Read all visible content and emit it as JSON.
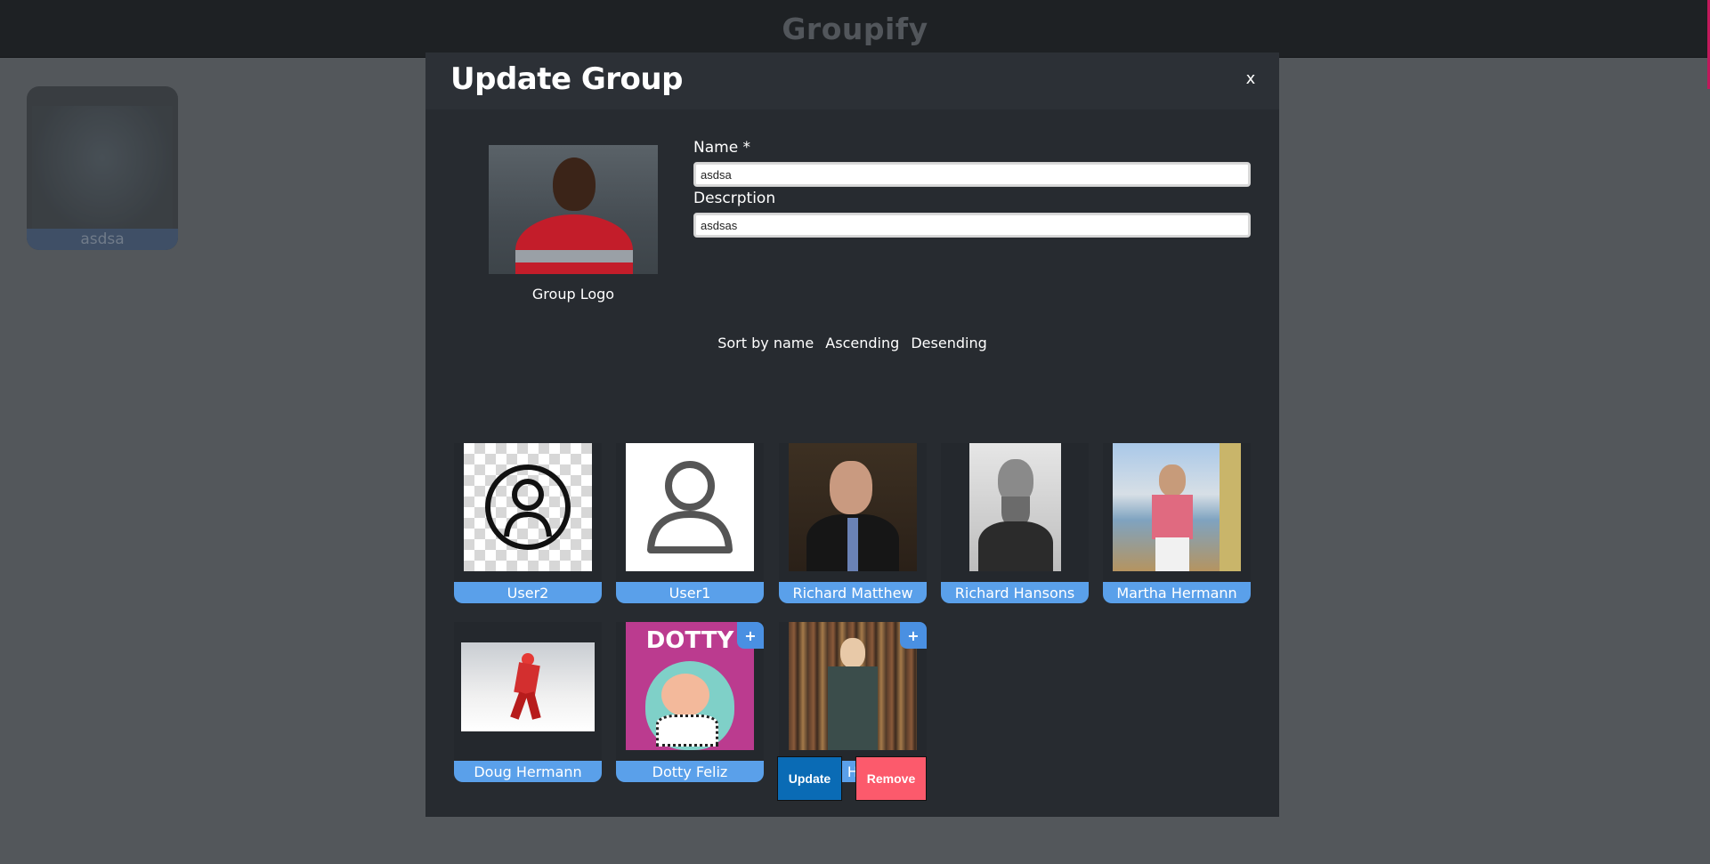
{
  "app": {
    "title": "Groupify"
  },
  "group_card": {
    "name": "asdsa"
  },
  "modal": {
    "title": "Update Group",
    "close_label": "x",
    "logo_caption": "Group Logo",
    "name_label": "Name *",
    "name_value": "asdsa",
    "description_label": "Descrption",
    "description_value": "asdsas",
    "sort": {
      "label": "Sort by name",
      "ascending": "Ascending",
      "descending": "Desending"
    },
    "add_label": "+",
    "members": [
      {
        "name": "User2"
      },
      {
        "name": "User1"
      },
      {
        "name": "Richard Matthew"
      },
      {
        "name": "Richard Hansons"
      },
      {
        "name": "Martha Hermann"
      },
      {
        "name": "Doug Hermann"
      },
      {
        "name": "Dotty Feliz",
        "cover_text": "DOTTY"
      },
      {
        "name": "Betty Hanson"
      }
    ],
    "update_label": "Update",
    "remove_label": "Remove"
  },
  "colors": {
    "page_bg": "#53575b",
    "modal_bg": "#272b30",
    "name_tag": "#5aa0ea",
    "update_button": "#0a6bb5",
    "remove_button": "#fc5a6c"
  }
}
